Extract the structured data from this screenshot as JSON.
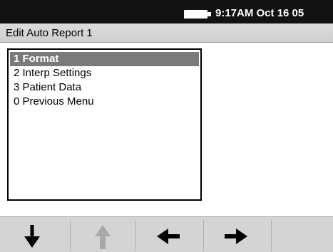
{
  "status_bar": {
    "time_date": "9:17AM Oct 16 05",
    "battery_icon": "battery-icon"
  },
  "title_bar": {
    "title": "Edit Auto Report 1"
  },
  "menu": {
    "items": [
      {
        "label": "1 Format",
        "selected": true
      },
      {
        "label": "2 Interp Settings",
        "selected": false
      },
      {
        "label": "3 Patient Data",
        "selected": false
      },
      {
        "label": "0 Previous Menu",
        "selected": false
      }
    ]
  },
  "softkeys": [
    {
      "icon": "arrow-down-icon",
      "enabled": true
    },
    {
      "icon": "arrow-up-icon",
      "enabled": false
    },
    {
      "icon": "arrow-left-icon",
      "enabled": true
    },
    {
      "icon": "arrow-right-icon",
      "enabled": true
    },
    {
      "icon": "",
      "enabled": false
    }
  ],
  "colors": {
    "status_bar_bg": "#121212",
    "title_bar_bg": "#d8d8d8",
    "selection_bg": "#7a7a7a",
    "softkey_bar_bg": "#d4d4d4",
    "arrow_enabled": "#000000",
    "arrow_disabled": "#a8a8a8"
  }
}
